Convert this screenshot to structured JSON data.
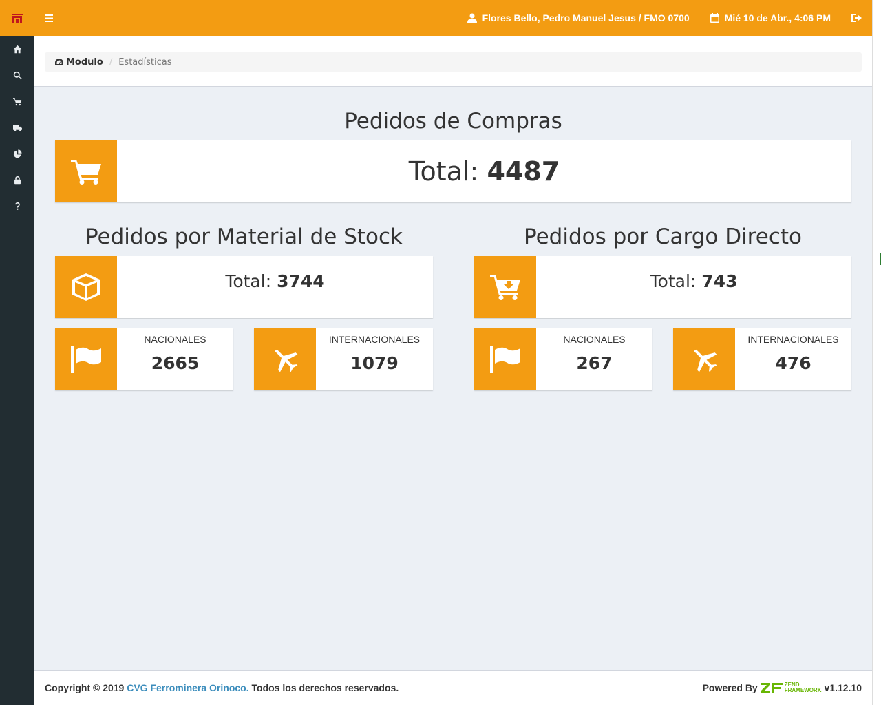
{
  "topbar": {
    "user": "Flores Bello, Pedro Manuel Jesus / FMO 0700",
    "datetime": "Mié 10 de Abr., 4:06 PM"
  },
  "sidebar": {
    "items": [
      {
        "icon": "home-icon"
      },
      {
        "icon": "search-icon"
      },
      {
        "icon": "cart-icon"
      },
      {
        "icon": "truck-icon"
      },
      {
        "icon": "pie-chart-icon"
      },
      {
        "icon": "lock-icon"
      },
      {
        "icon": "question-icon"
      }
    ]
  },
  "breadcrumb": {
    "home": "Modulo",
    "current": "Estadísticas"
  },
  "main": {
    "purchase_orders": {
      "title": "Pedidos de Compras",
      "total_label": "Total:",
      "total_value": "4487"
    },
    "stock": {
      "title": "Pedidos por Material de Stock",
      "total_label": "Total:",
      "total_value": "3744",
      "national_label": "NACIONALES",
      "national_value": "2665",
      "international_label": "INTERNACIONALES",
      "international_value": "1079"
    },
    "direct": {
      "title": "Pedidos por Cargo Directo",
      "total_label": "Total:",
      "total_value": "743",
      "national_label": "NACIONALES",
      "national_value": "267",
      "international_label": "INTERNACIONALES",
      "international_value": "476"
    }
  },
  "footer": {
    "copyright": "Copyright © 2019",
    "company": "CVG Ferrominera Orinoco.",
    "rights": "Todos los derechos reservados.",
    "powered_by": "Powered By",
    "zf_top": "ZEND",
    "zf_bottom": "FRAMEWORK",
    "version": "v1.12.10"
  },
  "colors": {
    "accent": "#f39c12",
    "sidebar": "#222d32",
    "background": "#ecf0f5",
    "link": "#3c8dbc"
  }
}
